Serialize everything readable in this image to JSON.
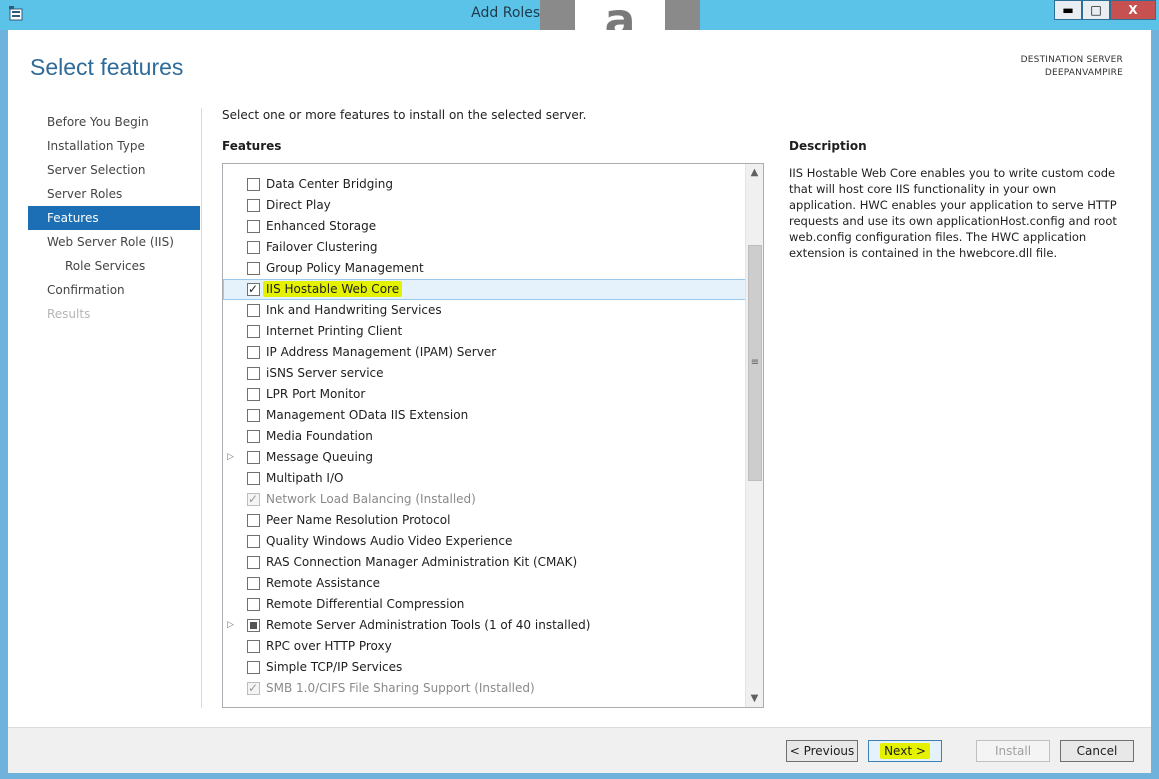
{
  "window": {
    "title": "Add Roles and Features Wizard",
    "minimize_glyph": "▬",
    "maximize_glyph": "□",
    "close_glyph": "X",
    "overlay_logo_letter": "a",
    "app_icon": "server-wizard-icon"
  },
  "header": {
    "page_title": "Select features",
    "destination_label": "DESTINATION SERVER",
    "destination_server": "DEEPANVAMPIRE"
  },
  "nav": {
    "items": [
      {
        "label": "Before You Begin",
        "state": "normal",
        "level": 0
      },
      {
        "label": "Installation Type",
        "state": "normal",
        "level": 0
      },
      {
        "label": "Server Selection",
        "state": "normal",
        "level": 0
      },
      {
        "label": "Server Roles",
        "state": "normal",
        "level": 0
      },
      {
        "label": "Features",
        "state": "active",
        "level": 0
      },
      {
        "label": "Web Server Role (IIS)",
        "state": "normal",
        "level": 0
      },
      {
        "label": "Role Services",
        "state": "normal",
        "level": 1
      },
      {
        "label": "Confirmation",
        "state": "normal",
        "level": 0
      },
      {
        "label": "Results",
        "state": "disabled",
        "level": 0
      }
    ]
  },
  "main": {
    "instructions": "Select one or more features to install on the selected server.",
    "features_label": "Features",
    "features": [
      {
        "label": "Data Center Bridging",
        "checked": false,
        "expandable": false,
        "installed": false
      },
      {
        "label": "Direct Play",
        "checked": false,
        "expandable": false,
        "installed": false
      },
      {
        "label": "Enhanced Storage",
        "checked": false,
        "expandable": false,
        "installed": false
      },
      {
        "label": "Failover Clustering",
        "checked": false,
        "expandable": false,
        "installed": false
      },
      {
        "label": "Group Policy Management",
        "checked": false,
        "expandable": false,
        "installed": false
      },
      {
        "label": "IIS Hostable Web Core",
        "checked": true,
        "expandable": false,
        "installed": false,
        "selected": true
      },
      {
        "label": "Ink and Handwriting Services",
        "checked": false,
        "expandable": false,
        "installed": false
      },
      {
        "label": "Internet Printing Client",
        "checked": false,
        "expandable": false,
        "installed": false
      },
      {
        "label": "IP Address Management (IPAM) Server",
        "checked": false,
        "expandable": false,
        "installed": false
      },
      {
        "label": "iSNS Server service",
        "checked": false,
        "expandable": false,
        "installed": false
      },
      {
        "label": "LPR Port Monitor",
        "checked": false,
        "expandable": false,
        "installed": false
      },
      {
        "label": "Management OData IIS Extension",
        "checked": false,
        "expandable": false,
        "installed": false
      },
      {
        "label": "Media Foundation",
        "checked": false,
        "expandable": false,
        "installed": false
      },
      {
        "label": "Message Queuing",
        "checked": false,
        "expandable": true,
        "installed": false
      },
      {
        "label": "Multipath I/O",
        "checked": false,
        "expandable": false,
        "installed": false
      },
      {
        "label": "Network Load Balancing (Installed)",
        "checked": true,
        "expandable": false,
        "installed": true
      },
      {
        "label": "Peer Name Resolution Protocol",
        "checked": false,
        "expandable": false,
        "installed": false
      },
      {
        "label": "Quality Windows Audio Video Experience",
        "checked": false,
        "expandable": false,
        "installed": false
      },
      {
        "label": "RAS Connection Manager Administration Kit (CMAK)",
        "checked": false,
        "expandable": false,
        "installed": false
      },
      {
        "label": "Remote Assistance",
        "checked": false,
        "expandable": false,
        "installed": false
      },
      {
        "label": "Remote Differential Compression",
        "checked": false,
        "expandable": false,
        "installed": false
      },
      {
        "label": "Remote Server Administration Tools (1 of 40 installed)",
        "checked": "partial",
        "expandable": true,
        "installed": false
      },
      {
        "label": "RPC over HTTP Proxy",
        "checked": false,
        "expandable": false,
        "installed": false
      },
      {
        "label": "Simple TCP/IP Services",
        "checked": false,
        "expandable": false,
        "installed": false
      },
      {
        "label": "SMB 1.0/CIFS File Sharing Support (Installed)",
        "checked": true,
        "expandable": false,
        "installed": true
      }
    ],
    "scroll": {
      "up_glyph": "▲",
      "down_glyph": "▼",
      "thumb_glyph": "≡"
    }
  },
  "description": {
    "title": "Description",
    "text": "IIS Hostable Web Core enables you to write custom code that will host core IIS functionality in your own application. HWC enables your application to serve HTTP requests and use its own applicationHost.config and root web.config configuration files. The HWC application extension is contained in the hwebcore.dll file."
  },
  "footer": {
    "previous_label": "< Previous",
    "next_label": "Next >",
    "install_label": "Install",
    "cancel_label": "Cancel"
  },
  "colors": {
    "accent": "#1c6fb5",
    "titlebar": "#5cc3e8",
    "highlight": "#e4f200"
  }
}
